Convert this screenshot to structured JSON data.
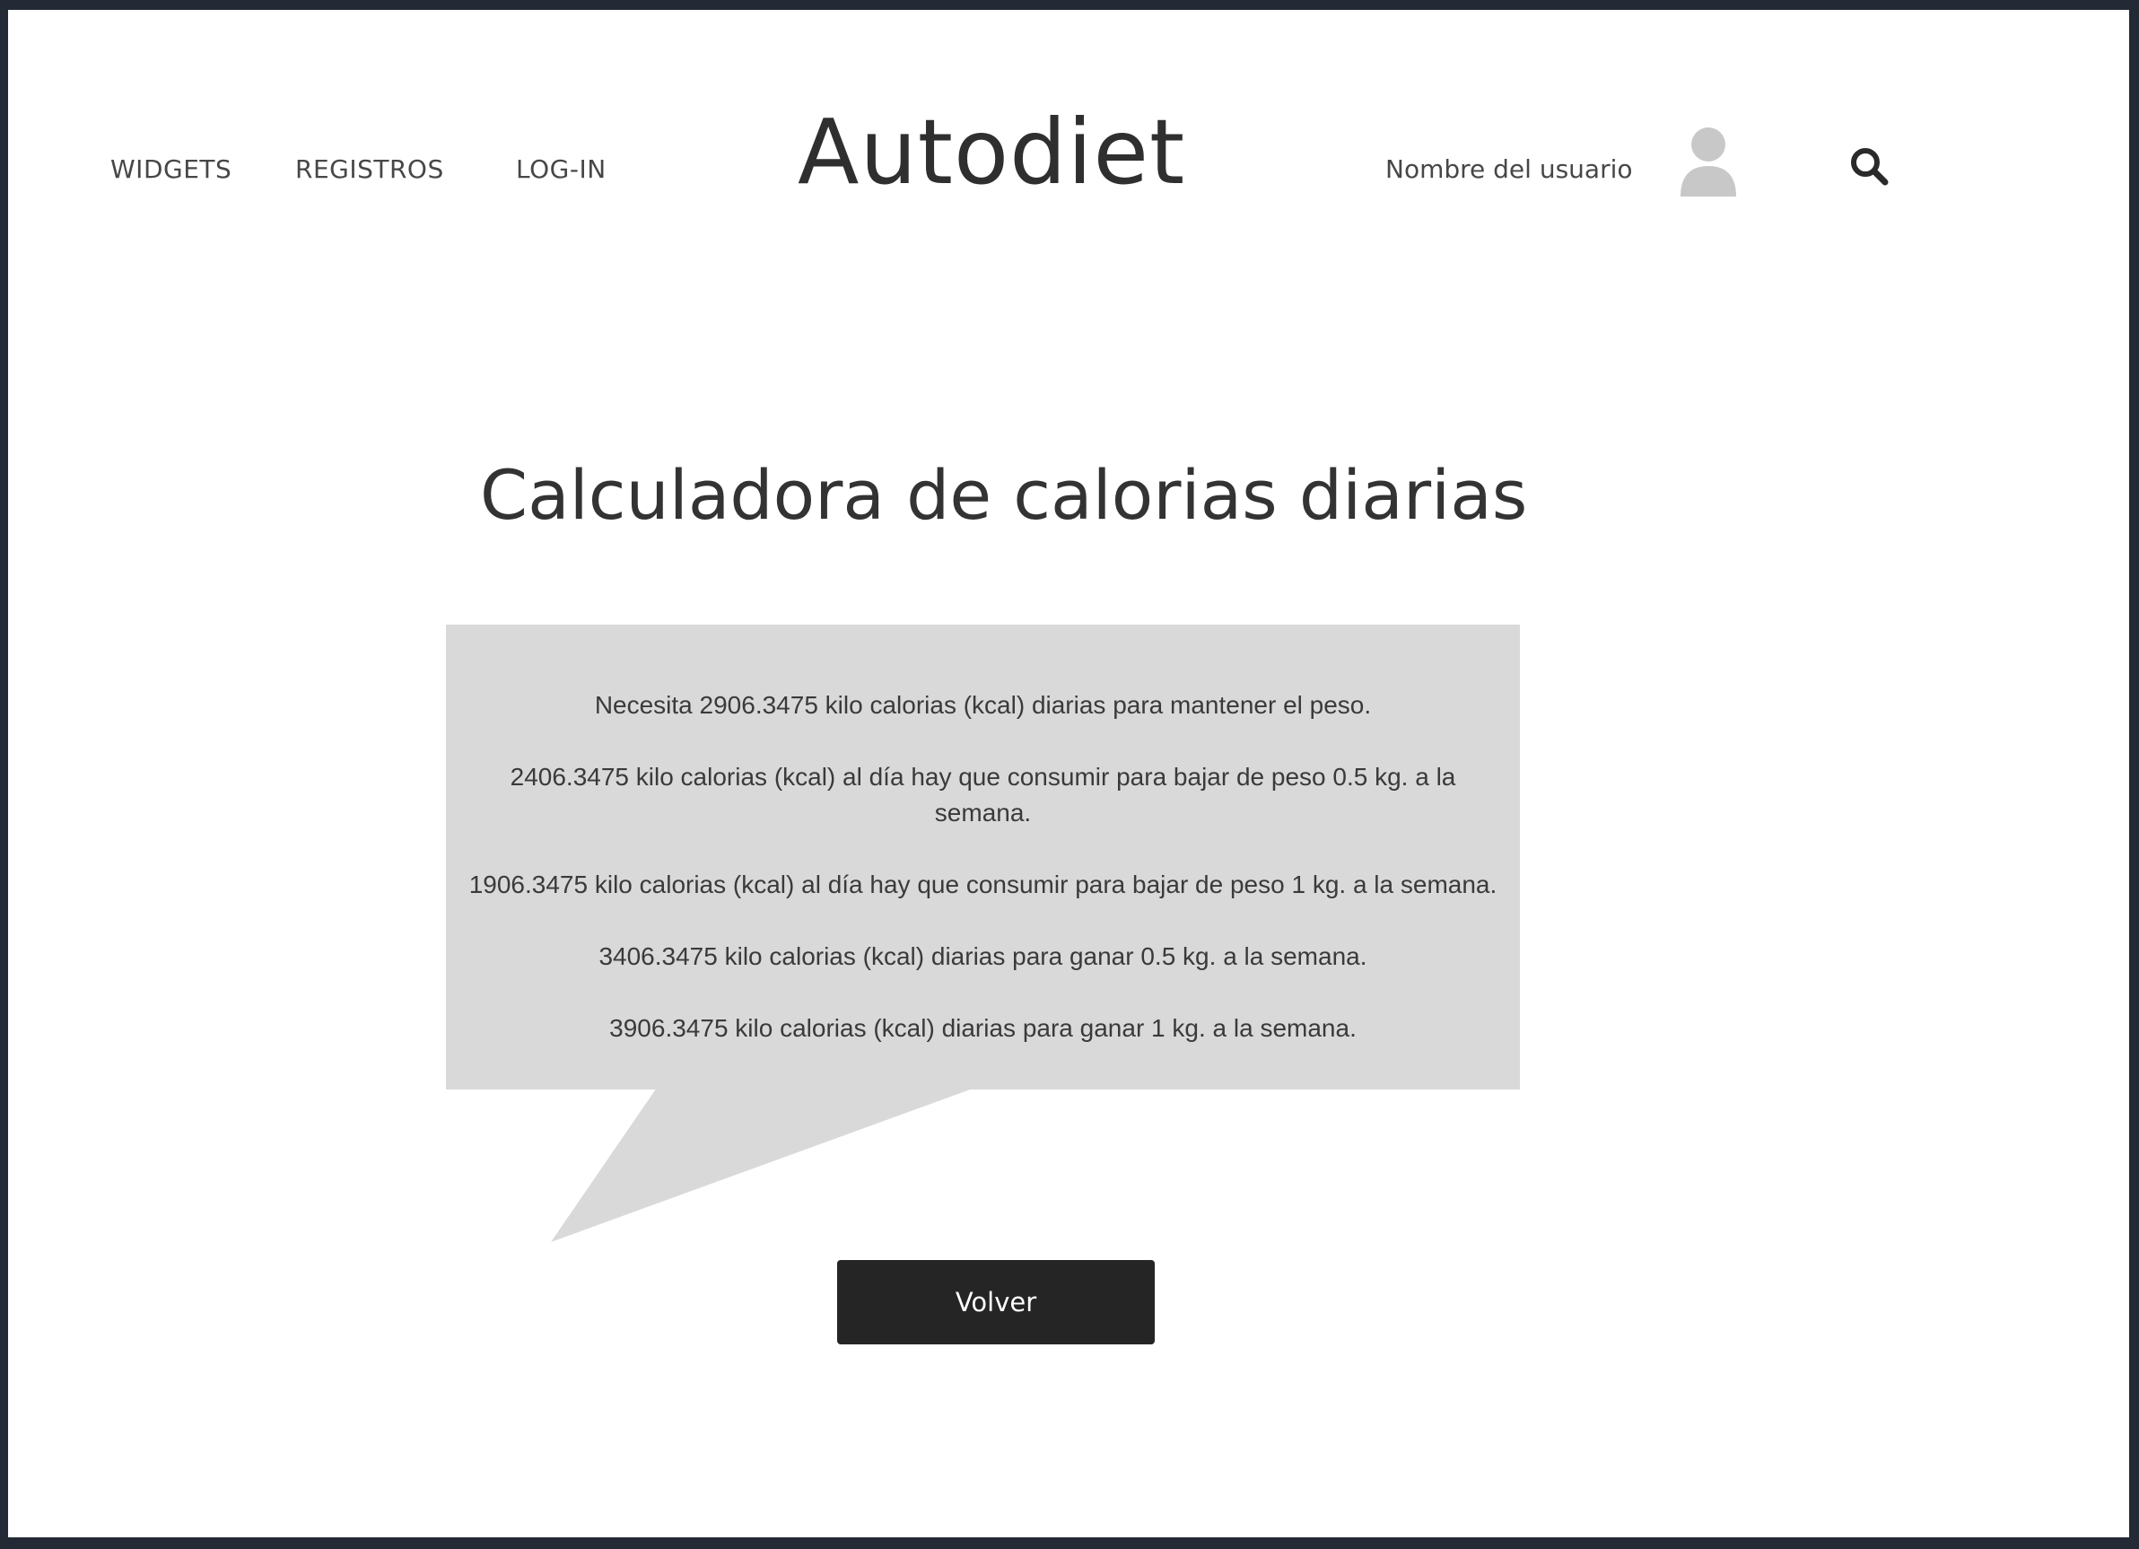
{
  "nav": {
    "widgets": "WIDGETS",
    "registros": "REGISTROS",
    "login": "LOG-IN"
  },
  "brand": {
    "logo": "Autodiet"
  },
  "user": {
    "name": "Nombre del usuario",
    "avatar_icon": "user-avatar-icon",
    "search_icon": "search-icon"
  },
  "main": {
    "title": "Calculadora de calorias diarias",
    "results": [
      "Necesita 2906.3475 kilo calorias (kcal) diarias para mantener el peso.",
      "2406.3475 kilo calorias (kcal) al día hay que consumir para bajar de peso 0.5 kg. a la semana.",
      "1906.3475 kilo calorias (kcal) al día hay que consumir para bajar de peso 1 kg. a la semana.",
      "3406.3475 kilo calorias (kcal) diarias para ganar 0.5 kg. a la semana.",
      "3906.3475 kilo calorias (kcal) diarias para ganar 1 kg. a la semana."
    ],
    "back_button": "Volver"
  },
  "colors": {
    "frame": "#232a35",
    "bubble": "#d9d9d9",
    "button": "#252525",
    "text": "#333333"
  }
}
